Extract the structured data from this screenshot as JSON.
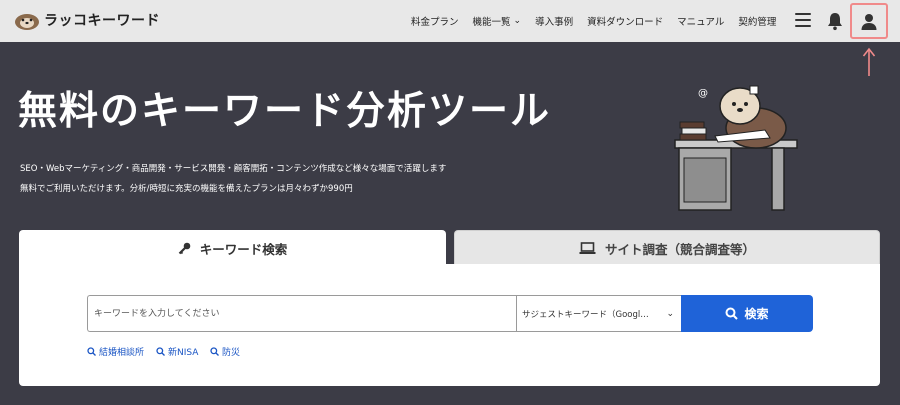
{
  "header": {
    "logo_text": "ラッコキーワード",
    "nav": [
      {
        "label": "料金プラン"
      },
      {
        "label": "機能一覧",
        "has_dropdown": true
      },
      {
        "label": "導入事例"
      },
      {
        "label": "資料ダウンロード"
      },
      {
        "label": "マニュアル"
      },
      {
        "label": "契約管理"
      }
    ],
    "icons": [
      "hamburger-menu-icon",
      "bell-icon",
      "user-icon"
    ]
  },
  "hero": {
    "title": "無料のキーワード分析ツール",
    "description_line1": "SEO・Webマーケティング・商品開発・サービス開発・顧客開拓・コンテンツ作成など様々な場面で活躍します",
    "description_line2": "無料でご利用いただけます。分析/時短に充実の機能を備えたプランは月々わずか990円"
  },
  "tabs": [
    {
      "label": "キーワード検索",
      "icon": "key-icon",
      "active": true
    },
    {
      "label": "サイト調査（競合調査等）",
      "icon": "laptop-icon",
      "active": false
    }
  ],
  "search": {
    "placeholder": "キーワードを入力してください",
    "value": "",
    "select_value": "サジェストキーワード（Googl…",
    "button_label": "検索"
  },
  "suggestions": [
    "結婚相談所",
    "新NISA",
    "防災"
  ],
  "colors": {
    "accent": "#1f63d8",
    "hero_bg": "#3c3c46",
    "header_bg": "#e8e8e8",
    "highlight": "#f08a8a"
  }
}
